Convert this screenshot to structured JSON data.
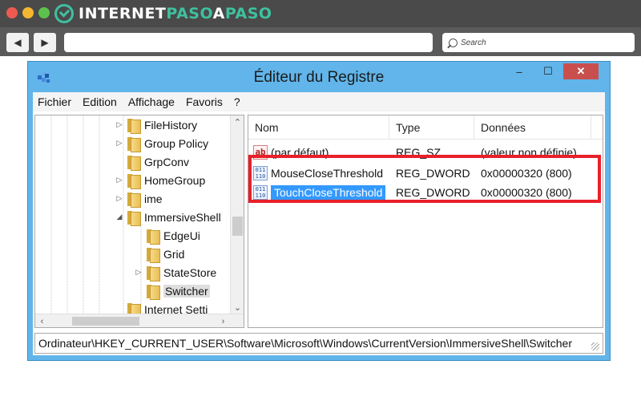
{
  "site": {
    "logo_part1": "INTERNET",
    "logo_part2": "PASO",
    "logo_part3": "A",
    "logo_part4": "PASO",
    "search_placeholder": "Search"
  },
  "browser": {
    "back": "◀",
    "forward": "▶"
  },
  "window": {
    "title": "Éditeur du Registre",
    "minimize": "–",
    "maximize": "☐",
    "close": "✕"
  },
  "menu": [
    "Fichier",
    "Edition",
    "Affichage",
    "Favoris",
    "?"
  ],
  "tree": {
    "items": [
      {
        "label": "FileHistory",
        "expander": "▷"
      },
      {
        "label": "Group Policy",
        "expander": "▷"
      },
      {
        "label": "GrpConv",
        "expander": ""
      },
      {
        "label": "HomeGroup",
        "expander": "▷"
      },
      {
        "label": "ime",
        "expander": "▷"
      },
      {
        "label": "ImmersiveShell",
        "expander": "◢"
      },
      {
        "label": "EdgeUi",
        "expander": ""
      },
      {
        "label": "Grid",
        "expander": ""
      },
      {
        "label": "StateStore",
        "expander": "▷"
      },
      {
        "label": "Switcher",
        "expander": ""
      },
      {
        "label": "Internet Setti",
        "expander": ""
      }
    ]
  },
  "list": {
    "columns": [
      "Nom",
      "Type",
      "Données"
    ],
    "rows": [
      {
        "icon": "string-value-icon",
        "name": "(par défaut)",
        "type": "REG_SZ",
        "data": "(valeur non définie)"
      },
      {
        "icon": "binary-value-icon",
        "name": "MouseCloseThreshold",
        "type": "REG_DWORD",
        "data": "0x00000320 (800)"
      },
      {
        "icon": "binary-value-icon",
        "name": "TouchCloseThreshold",
        "type": "REG_DWORD",
        "data": "0x00000320 (800)"
      }
    ]
  },
  "status": {
    "path": "Ordinateur\\HKEY_CURRENT_USER\\Software\\Microsoft\\Windows\\CurrentVersion\\ImmersiveShell\\Switcher"
  },
  "colors": {
    "accent": "#3fc0a0",
    "title_bar": "#61b5ea",
    "selection": "#3399ff",
    "highlight": "#e8202a"
  }
}
